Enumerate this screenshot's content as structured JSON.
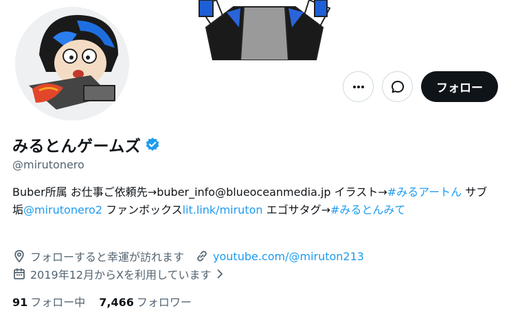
{
  "profile": {
    "display_name": "みるとんゲームズ",
    "handle": "@mirutonero",
    "follow_label": "フォロー",
    "verified_color": "#1d9bf0",
    "bio": {
      "part1": "Buber所属 お仕事ご依頼先→buber_info@blueoceanmedia.jp イラスト→",
      "tag1": "#みるアートん",
      "part2": " サブ垢",
      "mention": "@mirutonero2",
      "part3": " ファンボックス",
      "link": "lit.link/miruton",
      "part4": " エゴサタグ→",
      "tag2": "#みるとんみて"
    },
    "location": "フォローすると幸運が訪れます",
    "website": "youtube.com/@miruton213",
    "joined": "2019年12月からXを利用しています",
    "following_count": "91",
    "following_label": "フォロー中",
    "followers_count": "7,466",
    "followers_label": "フォロワー"
  },
  "icons": [
    "more-icon",
    "message-icon",
    "verified-badge-icon",
    "location-icon",
    "link-icon",
    "calendar-icon",
    "chevron-right-icon"
  ]
}
